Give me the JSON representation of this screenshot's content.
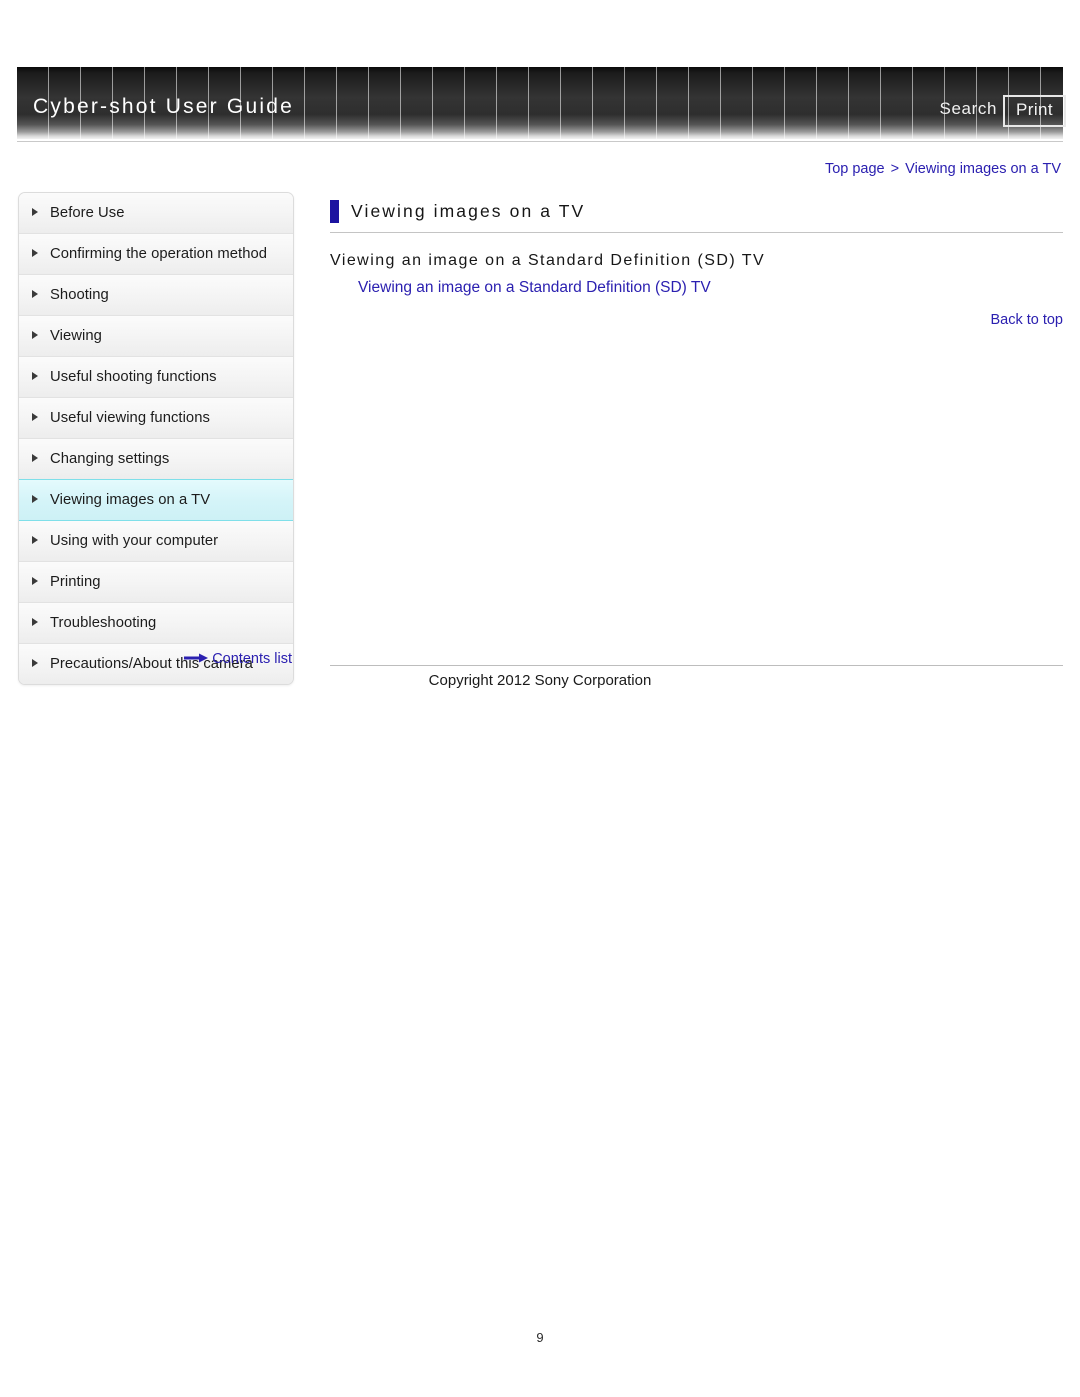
{
  "header": {
    "brand_title": "Cyber-shot User Guide",
    "search_label": "Search",
    "print_label": "Print"
  },
  "breadcrumb": {
    "top_page": "Top page",
    "separator": ">",
    "current": "Viewing images on a TV"
  },
  "sidebar": {
    "items": [
      {
        "label": "Before Use",
        "current": false
      },
      {
        "label": "Confirming the operation method",
        "current": false
      },
      {
        "label": "Shooting",
        "current": false
      },
      {
        "label": "Viewing",
        "current": false
      },
      {
        "label": "Useful shooting functions",
        "current": false
      },
      {
        "label": "Useful viewing functions",
        "current": false
      },
      {
        "label": "Changing settings",
        "current": false
      },
      {
        "label": "Viewing images on a TV",
        "current": true
      },
      {
        "label": "Using with your computer",
        "current": false
      },
      {
        "label": "Printing",
        "current": false
      },
      {
        "label": "Troubleshooting",
        "current": false
      },
      {
        "label": "Precautions/About this camera",
        "current": false
      }
    ],
    "contents_list_label": "Contents list"
  },
  "main": {
    "page_title": "Viewing images on a TV",
    "section_heading": "Viewing an image on a Standard Definition (SD) TV",
    "section_link": "Viewing an image on a Standard Definition (SD) TV",
    "back_to_top": "Back to top"
  },
  "footer": {
    "copyright": "Copyright 2012 Sony Corporation",
    "page_number": "9"
  },
  "colors": {
    "link_blue": "#2b20b0",
    "title_bar_navy": "#1c13a0",
    "highlight_cyan": "#d4f4f8",
    "highlight_border": "#7fdfe9"
  }
}
